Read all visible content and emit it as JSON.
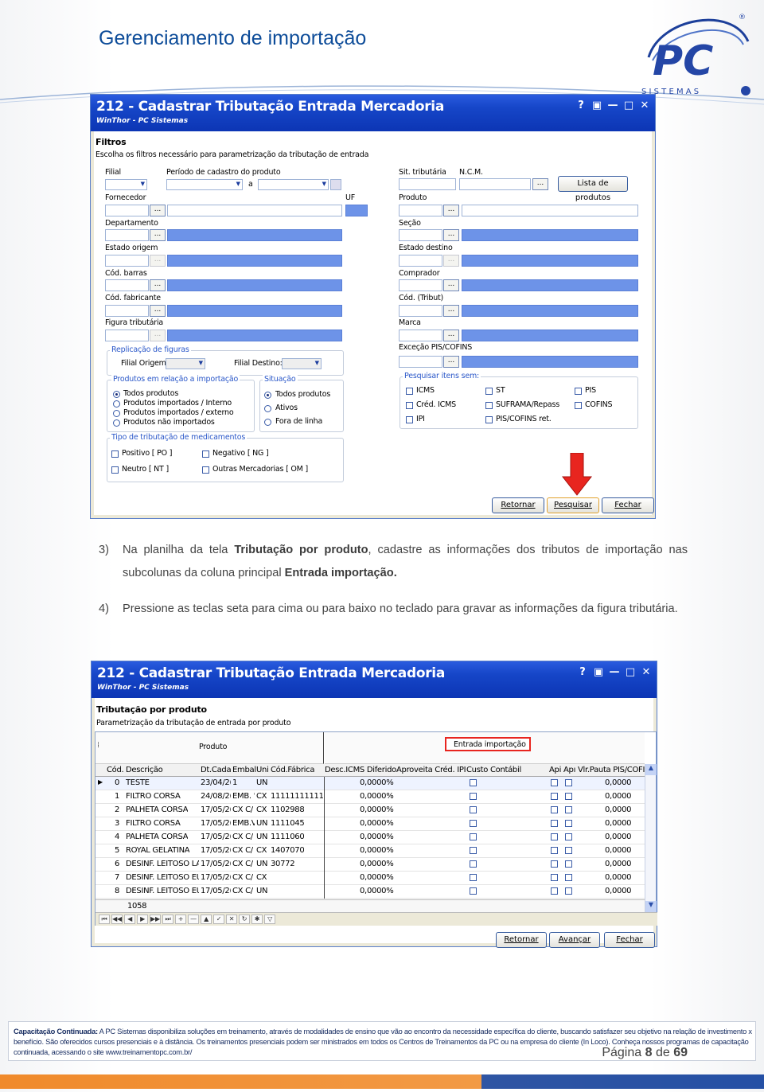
{
  "page": {
    "title": "Gerenciamento de importação",
    "logo_text": "PC",
    "logo_sub": "S I S T E M A S",
    "logo_registered": "®"
  },
  "window1": {
    "title": "212 - Cadastrar Tributação Entrada Mercadoria",
    "subtitle": "WinThor - PC Sistemas",
    "controls": [
      "?",
      "▣",
      "—",
      "□",
      "✕"
    ],
    "section_title": "Filtros",
    "section_desc": "Escolha os filtros necessário para parametrização da tributação de entrada",
    "labels": {
      "filial": "Filial",
      "periodo": "Período de cadastro do produto",
      "a": "a",
      "uf": "UF",
      "fornecedor": "Fornecedor",
      "departamento": "Departamento",
      "estado_origem": "Estado origem",
      "cod_barras": "Cód. barras",
      "cod_fabricante": "Cód. fabricante",
      "figura_tributaria": "Figura tributária",
      "sit_tributaria": "Sit. tributária",
      "ncm": "N.C.M.",
      "produto": "Produto",
      "secao": "Seção",
      "estado_destino": "Estado destino",
      "comprador": "Comprador",
      "cod_tribut": "Cód. (Tribut)",
      "marca": "Marca",
      "excecao": "Exceção PIS/COFINS"
    },
    "lista_produtos_button": "Lista de produtos",
    "ellipsis": "...",
    "replicacao": {
      "title": "Replicação de figuras",
      "filial_origem": "Filial Origem:",
      "filial_destino": "Filial Destino:"
    },
    "produtos_importacao": {
      "title": "Produtos em relação a importação",
      "options": [
        "Todos produtos",
        "Produtos importados / Interno",
        "Produtos importados / externo",
        "Produtos não importados"
      ],
      "selected": 0
    },
    "situacao": {
      "title": "Situação",
      "options": [
        "Todos produtos",
        "Ativos",
        "Fora de linha"
      ],
      "selected": 0
    },
    "medicamentos": {
      "title": "Tipo de tributação de medicamentos",
      "options": [
        "Positivo [ PO ]",
        "Negativo [ NG ]",
        "Neutro [ NT ]",
        "Outras Mercadorias [ OM ]"
      ]
    },
    "pesquisar_sem": {
      "title": "Pesquisar itens sem:",
      "options": [
        "ICMS",
        "ST",
        "PIS",
        "Créd. ICMS",
        "SUFRAMA/Repass",
        "COFINS",
        "IPI",
        "PIS/COFINS ret."
      ]
    },
    "buttons": {
      "retornar": "Retornar",
      "pesquisar": "Pesquisar",
      "fechar": "Fechar"
    },
    "arrow_color": "#e8251f"
  },
  "step3": {
    "num": "3)",
    "pre": "Na planilha da tela ",
    "bold1": "Tributação por produto",
    "mid": ", cadastre as informações dos tributos de importação nas subcolunas da coluna principal ",
    "bold2": "Entrada importação."
  },
  "step4": {
    "num": "4)",
    "text": "Pressione as teclas seta para cima ou para baixo no teclado para gravar as informações da figura tributária."
  },
  "window2": {
    "title": "212 - Cadastrar Tributação Entrada Mercadoria",
    "subtitle": "WinThor - PC Sistemas",
    "controls": [
      "?",
      "▣",
      "—",
      "□",
      "✕"
    ],
    "section_title": "Tributação por produto",
    "section_desc": "Parametrização da tributação de entrada por produto",
    "group_produto": "Produto",
    "group_entrada": "Entrada importação",
    "columns_left": [
      "Cód.",
      "Descrição",
      "Dt.Cada",
      "Embal",
      "Uni",
      "Cód.Fábrica"
    ],
    "columns_right": [
      "Desc.ICMS Diferido",
      "Aproveita Créd. IPI",
      "Custo Contábil",
      "Api",
      "Apı",
      "Vlr.Pauta PIS/COFI"
    ],
    "rows": [
      {
        "idx": "0",
        "desc": "TESTE",
        "dt": "23/04/2(",
        "emb": "1",
        "uni": "UN",
        "fab": "",
        "dif": "0,0000%",
        "vlr": "0,0000"
      },
      {
        "idx": "1",
        "desc": "FILTRO CORSA",
        "dt": "24/08/2(",
        "emb": "EMB. '",
        "uni": "CX",
        "fab": "111111111111",
        "dif": "0,0000%",
        "vlr": "0,0000"
      },
      {
        "idx": "2",
        "desc": "PALHETA CORSA",
        "dt": "17/05/2(",
        "emb": "CX C/",
        "uni": "CX",
        "fab": "1102988",
        "dif": "0,0000%",
        "vlr": "0,0000"
      },
      {
        "idx": "3",
        "desc": "FILTRO CORSA",
        "dt": "17/05/2(",
        "emb": "EMB.V",
        "uni": "UN",
        "fab": "1111045",
        "dif": "0,0000%",
        "vlr": "0,0000"
      },
      {
        "idx": "4",
        "desc": "PALHETA CORSA",
        "dt": "17/05/2(",
        "emb": "CX C/",
        "uni": "UN",
        "fab": "1111060",
        "dif": "0,0000%",
        "vlr": "0,0000"
      },
      {
        "idx": "5",
        "desc": "ROYAL GELATINA",
        "dt": "17/05/2(",
        "emb": "CX C/",
        "uni": "CX",
        "fab": "1407070",
        "dif": "0,0000%",
        "vlr": "0,0000"
      },
      {
        "idx": "6",
        "desc": "DESINF. LEITOSO LA",
        "dt": "17/05/2(",
        "emb": "CX C/",
        "uni": "UN",
        "fab": "30772",
        "dif": "0,0000%",
        "vlr": "0,0000"
      },
      {
        "idx": "7",
        "desc": "DESINF. LEITOSO EU",
        "dt": "17/05/2(",
        "emb": "CX C/",
        "uni": "CX",
        "fab": "",
        "dif": "0,0000%",
        "vlr": "0,0000"
      },
      {
        "idx": "8",
        "desc": "DESINF. LEITOSO EU",
        "dt": "17/05/2(",
        "emb": "CX C/",
        "uni": "UN",
        "fab": "",
        "dif": "0,0000%",
        "vlr": "0,0000"
      }
    ],
    "count": "1058",
    "nav_icons": [
      "⏮",
      "◀◀",
      "◀",
      "▶",
      "▶▶",
      "⏭",
      "+",
      "—",
      "▲",
      "✓",
      "✕",
      "↻",
      "✱",
      "▽"
    ],
    "buttons": {
      "retornar": "Retornar",
      "avancar": "Avançar",
      "fechar": "Fechar"
    },
    "highlight_color": "#e8251f"
  },
  "footer": {
    "label": "Capacitação Continuada:",
    "text": " A PC Sistemas disponibiliza soluções em treinamento, através de modalidades de ensino que vão ao encontro da necessidade específica do cliente, buscando satisfazer seu objetivo na relação de investimento x benefício. São oferecidos cursos presenciais e à distância. Os treinamentos presenciais podem ser ministrados em todos os Centros de Treinamentos da PC ou na empresa do cliente (In Loco). Conheça nossos programas de capacitação continuada, acessando o site www.treinamentopc.com.br/"
  },
  "pagination": {
    "prefix": "Página",
    "current": "8",
    "sep": "de",
    "total": "69"
  }
}
